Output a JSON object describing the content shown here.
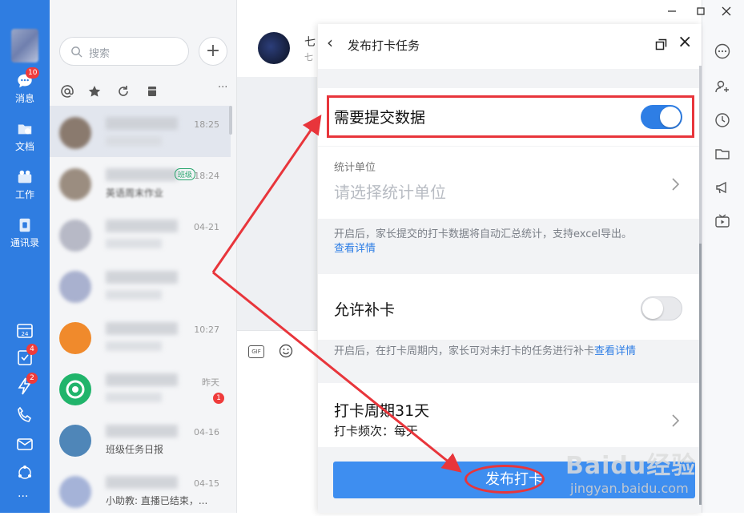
{
  "rail": {
    "items": [
      {
        "label": "消息",
        "badge": "10"
      },
      {
        "label": "文档"
      },
      {
        "label": "工作"
      },
      {
        "label": "通讯录"
      }
    ],
    "bottom_badges": {
      "tasks": "4",
      "flash": "2"
    }
  },
  "list": {
    "search_placeholder": "搜索",
    "add_symbol": "+",
    "more_symbol": "···",
    "conversations": [
      {
        "time": "18:25",
        "snippet": "",
        "tag": ""
      },
      {
        "time": "18:24",
        "snippet": "英语周末作业",
        "tag": "班级"
      },
      {
        "time": "04-21",
        "snippet": "",
        "tag": ""
      },
      {
        "time": "",
        "snippet": "",
        "tag": ""
      },
      {
        "time": "10:27",
        "snippet": "",
        "tag": ""
      },
      {
        "time": "昨天",
        "snippet": "",
        "tag": "",
        "badge": "1"
      },
      {
        "time": "04-16",
        "snippet": "班级任务日报",
        "tag": ""
      },
      {
        "time": "04-15",
        "snippet": "小助教: 直播已结束，...",
        "tag": ""
      }
    ]
  },
  "chat": {
    "name_partial": "七",
    "sub_partial": "七",
    "gif_label": "GIF"
  },
  "dialog": {
    "back_symbol": "‹",
    "title": "发布打卡任务",
    "close_symbol": "×",
    "require_data_label": "需要提交数据",
    "require_data_on": true,
    "unit_label": "统计单位",
    "unit_placeholder": "请选择统计单位",
    "unit_hint": "开启后，家长提交的打卡数据将自动汇总统计，支持excel导出。",
    "unit_hint_link": "查看详情",
    "makeup_label": "允许补卡",
    "makeup_on": false,
    "makeup_hint": "开启后，在打卡周期内，家长可对未打卡的任务进行补卡",
    "makeup_hint_link": "查看详情",
    "period_label": "打卡周期31天",
    "period_sub": "打卡频次：每天",
    "publish_label": "发布打卡"
  },
  "watermark": {
    "brand": "Baidu经验",
    "url": "jingyan.baidu.com"
  },
  "colors": {
    "accent": "#2e7ee5",
    "rail": "#2f7de1",
    "annotation": "#e8353b"
  }
}
